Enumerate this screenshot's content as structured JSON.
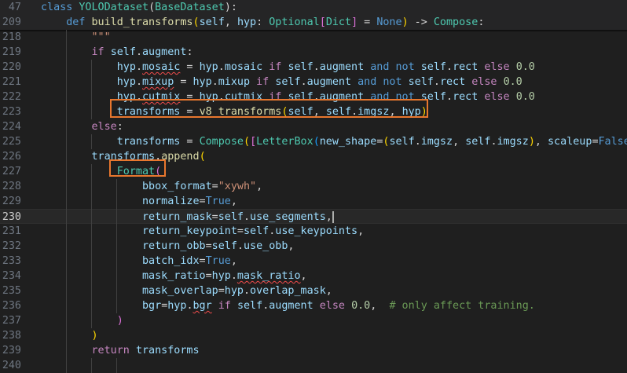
{
  "editor": {
    "sticky": [
      {
        "ln": "47",
        "tokens": [
          [
            "kw",
            "class "
          ],
          [
            "cls",
            "YOLODataset"
          ],
          [
            "op",
            "("
          ],
          [
            "cls",
            "BaseDataset"
          ],
          [
            "op",
            "):"
          ]
        ]
      },
      {
        "ln": "209",
        "tokens": [
          [
            "kw",
            "    def "
          ],
          [
            "fn",
            "build_transforms"
          ],
          [
            "par1",
            "("
          ],
          [
            "var",
            "self"
          ],
          [
            "op",
            ", "
          ],
          [
            "var",
            "hyp"
          ],
          [
            "op",
            ": "
          ],
          [
            "cls",
            "Optional"
          ],
          [
            "par",
            "["
          ],
          [
            "cls",
            "Dict"
          ],
          [
            "par",
            "]"
          ],
          [
            "op",
            " = "
          ],
          [
            "kw",
            "None"
          ],
          [
            "par1",
            ")"
          ],
          [
            "op",
            " -> "
          ],
          [
            "cls",
            "Compose"
          ],
          [
            "op",
            ":"
          ]
        ]
      }
    ],
    "lines": [
      {
        "ln": "218",
        "tokens": [
          [
            "str",
            "        \"\"\""
          ]
        ]
      },
      {
        "ln": "219",
        "tokens": [
          [
            "ctl",
            "        if "
          ],
          [
            "var",
            "self"
          ],
          [
            "op",
            "."
          ],
          [
            "var",
            "augment"
          ],
          [
            "op",
            ":"
          ]
        ]
      },
      {
        "ln": "220",
        "tokens": [
          [
            "var",
            "            hyp"
          ],
          [
            "op",
            "."
          ],
          [
            "var sq",
            "mosaic"
          ],
          [
            "op",
            " = "
          ],
          [
            "var",
            "hyp"
          ],
          [
            "op",
            "."
          ],
          [
            "var",
            "mosaic"
          ],
          [
            "ctl",
            " if "
          ],
          [
            "var",
            "self"
          ],
          [
            "op",
            "."
          ],
          [
            "var",
            "augment"
          ],
          [
            "kw",
            " and not "
          ],
          [
            "var",
            "self"
          ],
          [
            "op",
            "."
          ],
          [
            "var",
            "rect"
          ],
          [
            "ctl",
            " else "
          ],
          [
            "num",
            "0.0"
          ]
        ]
      },
      {
        "ln": "221",
        "tokens": [
          [
            "var",
            "            hyp"
          ],
          [
            "op",
            "."
          ],
          [
            "var sq",
            "mixup"
          ],
          [
            "op",
            " = "
          ],
          [
            "var",
            "hyp"
          ],
          [
            "op",
            "."
          ],
          [
            "var",
            "mixup"
          ],
          [
            "ctl",
            " if "
          ],
          [
            "var",
            "self"
          ],
          [
            "op",
            "."
          ],
          [
            "var",
            "augment"
          ],
          [
            "kw",
            " and not "
          ],
          [
            "var",
            "self"
          ],
          [
            "op",
            "."
          ],
          [
            "var",
            "rect"
          ],
          [
            "ctl",
            " else "
          ],
          [
            "num",
            "0.0"
          ]
        ]
      },
      {
        "ln": "222",
        "tokens": [
          [
            "var",
            "            hyp"
          ],
          [
            "op",
            "."
          ],
          [
            "var sq",
            "cutmix"
          ],
          [
            "op",
            " = "
          ],
          [
            "var",
            "hyp"
          ],
          [
            "op",
            "."
          ],
          [
            "var",
            "cutmix"
          ],
          [
            "ctl",
            " if "
          ],
          [
            "var",
            "self"
          ],
          [
            "op",
            "."
          ],
          [
            "var",
            "augment"
          ],
          [
            "kw",
            " and not "
          ],
          [
            "var",
            "self"
          ],
          [
            "op",
            "."
          ],
          [
            "var",
            "rect"
          ],
          [
            "ctl",
            " else "
          ],
          [
            "num",
            "0.0"
          ]
        ]
      },
      {
        "ln": "223",
        "tokens": [
          [
            "var",
            "            transforms"
          ],
          [
            "op",
            " = "
          ],
          [
            "fn",
            "v8_transforms"
          ],
          [
            "par1",
            "("
          ],
          [
            "var",
            "self"
          ],
          [
            "op",
            ", "
          ],
          [
            "var",
            "self"
          ],
          [
            "op",
            "."
          ],
          [
            "var",
            "imgsz"
          ],
          [
            "op",
            ", "
          ],
          [
            "var",
            "hyp"
          ],
          [
            "par1",
            ")"
          ]
        ]
      },
      {
        "ln": "224",
        "tokens": [
          [
            "ctl",
            "        else"
          ],
          [
            "op",
            ":"
          ]
        ]
      },
      {
        "ln": "225",
        "tokens": [
          [
            "var",
            "            transforms"
          ],
          [
            "op",
            " = "
          ],
          [
            "cls",
            "Compose"
          ],
          [
            "par1",
            "("
          ],
          [
            "par",
            "["
          ],
          [
            "cls",
            "LetterBox"
          ],
          [
            "par2",
            "("
          ],
          [
            "var",
            "new_shape"
          ],
          [
            "op",
            "="
          ],
          [
            "par1",
            "("
          ],
          [
            "var",
            "self"
          ],
          [
            "op",
            "."
          ],
          [
            "var",
            "imgsz"
          ],
          [
            "op",
            ", "
          ],
          [
            "var",
            "self"
          ],
          [
            "op",
            "."
          ],
          [
            "var",
            "imgsz"
          ],
          [
            "par1",
            ")"
          ],
          [
            "op",
            ", "
          ],
          [
            "var",
            "scaleup"
          ],
          [
            "op",
            "="
          ],
          [
            "kw",
            "False"
          ],
          [
            "par2",
            ")"
          ],
          [
            "par",
            "]"
          ],
          [
            "par1",
            ")"
          ]
        ]
      },
      {
        "ln": "226",
        "tokens": [
          [
            "var",
            "        transforms"
          ],
          [
            "op",
            "."
          ],
          [
            "fn",
            "append"
          ],
          [
            "par1",
            "("
          ]
        ]
      },
      {
        "ln": "227",
        "tokens": [
          [
            "cls",
            "            Format"
          ],
          [
            "par",
            "("
          ]
        ]
      },
      {
        "ln": "228",
        "tokens": [
          [
            "var",
            "                bbox_format"
          ],
          [
            "op",
            "="
          ],
          [
            "str",
            "\"xywh\""
          ],
          [
            "op",
            ","
          ]
        ]
      },
      {
        "ln": "229",
        "tokens": [
          [
            "var",
            "                normalize"
          ],
          [
            "op",
            "="
          ],
          [
            "kw",
            "True"
          ],
          [
            "op",
            ","
          ]
        ]
      },
      {
        "ln": "230",
        "tokens": [
          [
            "var",
            "                return_mask"
          ],
          [
            "op",
            "="
          ],
          [
            "var",
            "self"
          ],
          [
            "op",
            "."
          ],
          [
            "var",
            "use_segments"
          ],
          [
            "op",
            ","
          ]
        ],
        "cursor": true
      },
      {
        "ln": "231",
        "tokens": [
          [
            "var",
            "                return_keypoint"
          ],
          [
            "op",
            "="
          ],
          [
            "var",
            "self"
          ],
          [
            "op",
            "."
          ],
          [
            "var",
            "use_keypoints"
          ],
          [
            "op",
            ","
          ]
        ]
      },
      {
        "ln": "232",
        "tokens": [
          [
            "var",
            "                return_obb"
          ],
          [
            "op",
            "="
          ],
          [
            "var",
            "self"
          ],
          [
            "op",
            "."
          ],
          [
            "var",
            "use_obb"
          ],
          [
            "op",
            ","
          ]
        ]
      },
      {
        "ln": "233",
        "tokens": [
          [
            "var",
            "                batch_idx"
          ],
          [
            "op",
            "="
          ],
          [
            "kw",
            "True"
          ],
          [
            "op",
            ","
          ]
        ]
      },
      {
        "ln": "234",
        "tokens": [
          [
            "var",
            "                mask_ratio"
          ],
          [
            "op",
            "="
          ],
          [
            "var",
            "hyp"
          ],
          [
            "op",
            "."
          ],
          [
            "var sq",
            "mask_ratio"
          ],
          [
            "op",
            ","
          ]
        ]
      },
      {
        "ln": "235",
        "tokens": [
          [
            "var",
            "                mask_overlap"
          ],
          [
            "op",
            "="
          ],
          [
            "var",
            "hyp"
          ],
          [
            "op",
            "."
          ],
          [
            "var",
            "overlap_mask"
          ],
          [
            "op",
            ","
          ]
        ]
      },
      {
        "ln": "236",
        "tokens": [
          [
            "var",
            "                bgr"
          ],
          [
            "op",
            "="
          ],
          [
            "var",
            "hyp"
          ],
          [
            "op",
            "."
          ],
          [
            "var sq",
            "bgr"
          ],
          [
            "ctl",
            " if "
          ],
          [
            "var",
            "self"
          ],
          [
            "op",
            "."
          ],
          [
            "var",
            "augment"
          ],
          [
            "ctl",
            " else "
          ],
          [
            "num",
            "0.0"
          ],
          [
            "op",
            ",  "
          ],
          [
            "cmt",
            "# only affect training."
          ]
        ]
      },
      {
        "ln": "237",
        "tokens": [
          [
            "par",
            "            )"
          ]
        ]
      },
      {
        "ln": "238",
        "tokens": [
          [
            "par1",
            "        )"
          ]
        ]
      },
      {
        "ln": "239",
        "tokens": [
          [
            "ctl",
            "        return "
          ],
          [
            "var",
            "transforms"
          ]
        ]
      },
      {
        "ln": "240",
        "tokens": []
      }
    ]
  }
}
